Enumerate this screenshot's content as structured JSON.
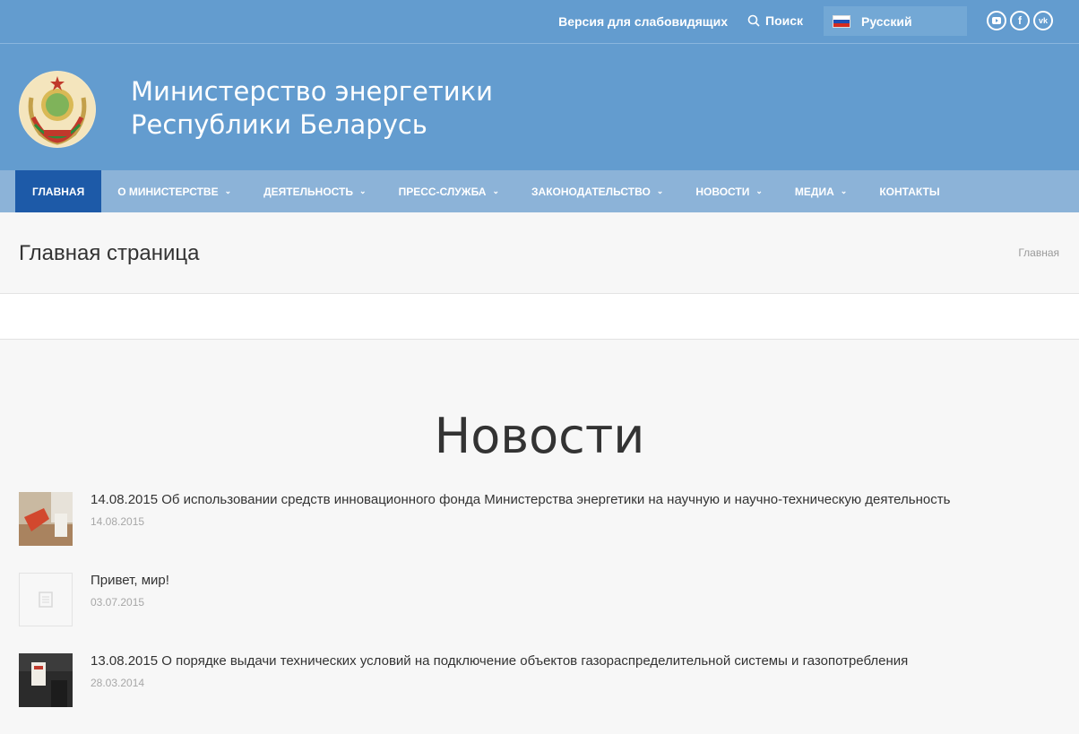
{
  "topbar": {
    "a11y_label": "Версия для слабовидящих",
    "search_label": "Поиск",
    "language": "Русский"
  },
  "site": {
    "title_line1": "Министерство энергетики",
    "title_line2": "Республики Беларусь"
  },
  "nav": {
    "items": [
      {
        "label": "ГЛАВНАЯ"
      },
      {
        "label": "О МИНИСТЕРСТВЕ"
      },
      {
        "label": "ДЕЯТЕЛЬНОСТЬ"
      },
      {
        "label": "ПРЕСС-СЛУЖБА"
      },
      {
        "label": "ЗАКОНОДАТЕЛЬСТВО"
      },
      {
        "label": "НОВОСТИ"
      },
      {
        "label": "МЕДИА"
      },
      {
        "label": "КОНТАКТЫ"
      }
    ]
  },
  "page": {
    "heading": "Главная страница",
    "breadcrumb": "Главная"
  },
  "news": {
    "section_title": "Новости",
    "items": [
      {
        "title": "14.08.2015 Об использовании средств инновационного фонда Министерства энергетики на научную и научно-техническую деятельность",
        "date": "14.08.2015"
      },
      {
        "title": "Привет, мир!",
        "date": "03.07.2015"
      },
      {
        "title": "13.08.2015 О порядке выдачи технических условий на подключение объектов газораспределительной системы и газопотребления",
        "date": "28.03.2014"
      }
    ]
  },
  "colors": {
    "header_bg": "#639ccf",
    "nav_bg": "#8cb3d8",
    "nav_active": "#1d5aa8"
  },
  "icons": [
    "search-icon",
    "russia-flag-icon",
    "youtube-icon",
    "facebook-icon",
    "vk-icon",
    "emblem-logo",
    "document-placeholder-icon"
  ]
}
